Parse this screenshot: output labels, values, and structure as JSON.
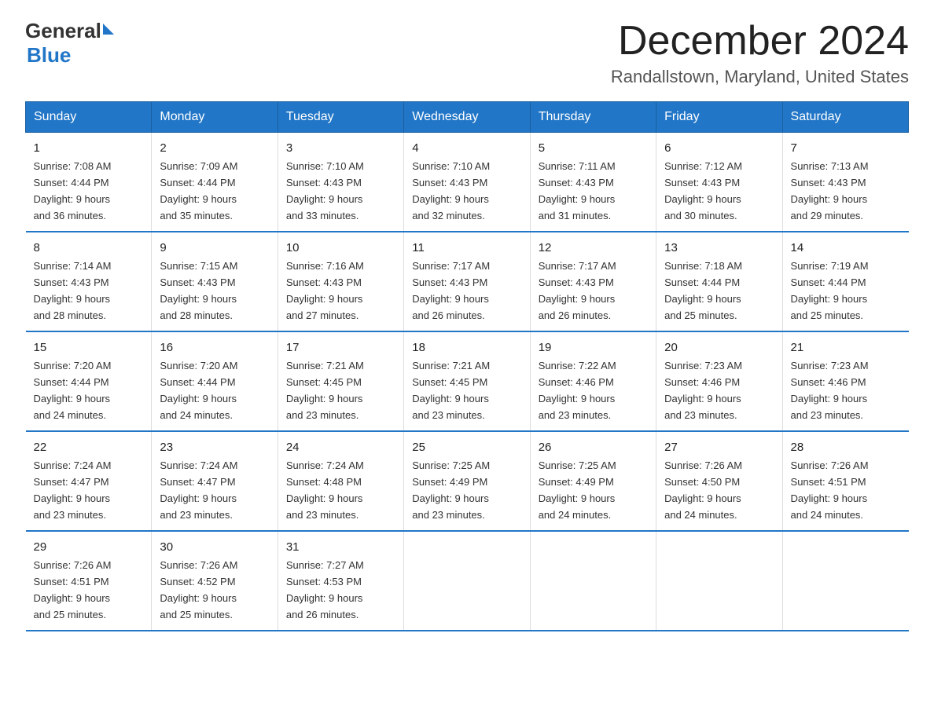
{
  "logo": {
    "general": "General",
    "blue": "Blue",
    "triangle": "▶"
  },
  "title": "December 2024",
  "subtitle": "Randallstown, Maryland, United States",
  "days_of_week": [
    "Sunday",
    "Monday",
    "Tuesday",
    "Wednesday",
    "Thursday",
    "Friday",
    "Saturday"
  ],
  "weeks": [
    [
      {
        "day": "1",
        "sunrise": "7:08 AM",
        "sunset": "4:44 PM",
        "daylight": "9 hours and 36 minutes."
      },
      {
        "day": "2",
        "sunrise": "7:09 AM",
        "sunset": "4:44 PM",
        "daylight": "9 hours and 35 minutes."
      },
      {
        "day": "3",
        "sunrise": "7:10 AM",
        "sunset": "4:43 PM",
        "daylight": "9 hours and 33 minutes."
      },
      {
        "day": "4",
        "sunrise": "7:10 AM",
        "sunset": "4:43 PM",
        "daylight": "9 hours and 32 minutes."
      },
      {
        "day": "5",
        "sunrise": "7:11 AM",
        "sunset": "4:43 PM",
        "daylight": "9 hours and 31 minutes."
      },
      {
        "day": "6",
        "sunrise": "7:12 AM",
        "sunset": "4:43 PM",
        "daylight": "9 hours and 30 minutes."
      },
      {
        "day": "7",
        "sunrise": "7:13 AM",
        "sunset": "4:43 PM",
        "daylight": "9 hours and 29 minutes."
      }
    ],
    [
      {
        "day": "8",
        "sunrise": "7:14 AM",
        "sunset": "4:43 PM",
        "daylight": "9 hours and 28 minutes."
      },
      {
        "day": "9",
        "sunrise": "7:15 AM",
        "sunset": "4:43 PM",
        "daylight": "9 hours and 28 minutes."
      },
      {
        "day": "10",
        "sunrise": "7:16 AM",
        "sunset": "4:43 PM",
        "daylight": "9 hours and 27 minutes."
      },
      {
        "day": "11",
        "sunrise": "7:17 AM",
        "sunset": "4:43 PM",
        "daylight": "9 hours and 26 minutes."
      },
      {
        "day": "12",
        "sunrise": "7:17 AM",
        "sunset": "4:43 PM",
        "daylight": "9 hours and 26 minutes."
      },
      {
        "day": "13",
        "sunrise": "7:18 AM",
        "sunset": "4:44 PM",
        "daylight": "9 hours and 25 minutes."
      },
      {
        "day": "14",
        "sunrise": "7:19 AM",
        "sunset": "4:44 PM",
        "daylight": "9 hours and 25 minutes."
      }
    ],
    [
      {
        "day": "15",
        "sunrise": "7:20 AM",
        "sunset": "4:44 PM",
        "daylight": "9 hours and 24 minutes."
      },
      {
        "day": "16",
        "sunrise": "7:20 AM",
        "sunset": "4:44 PM",
        "daylight": "9 hours and 24 minutes."
      },
      {
        "day": "17",
        "sunrise": "7:21 AM",
        "sunset": "4:45 PM",
        "daylight": "9 hours and 23 minutes."
      },
      {
        "day": "18",
        "sunrise": "7:21 AM",
        "sunset": "4:45 PM",
        "daylight": "9 hours and 23 minutes."
      },
      {
        "day": "19",
        "sunrise": "7:22 AM",
        "sunset": "4:46 PM",
        "daylight": "9 hours and 23 minutes."
      },
      {
        "day": "20",
        "sunrise": "7:23 AM",
        "sunset": "4:46 PM",
        "daylight": "9 hours and 23 minutes."
      },
      {
        "day": "21",
        "sunrise": "7:23 AM",
        "sunset": "4:46 PM",
        "daylight": "9 hours and 23 minutes."
      }
    ],
    [
      {
        "day": "22",
        "sunrise": "7:24 AM",
        "sunset": "4:47 PM",
        "daylight": "9 hours and 23 minutes."
      },
      {
        "day": "23",
        "sunrise": "7:24 AM",
        "sunset": "4:47 PM",
        "daylight": "9 hours and 23 minutes."
      },
      {
        "day": "24",
        "sunrise": "7:24 AM",
        "sunset": "4:48 PM",
        "daylight": "9 hours and 23 minutes."
      },
      {
        "day": "25",
        "sunrise": "7:25 AM",
        "sunset": "4:49 PM",
        "daylight": "9 hours and 23 minutes."
      },
      {
        "day": "26",
        "sunrise": "7:25 AM",
        "sunset": "4:49 PM",
        "daylight": "9 hours and 24 minutes."
      },
      {
        "day": "27",
        "sunrise": "7:26 AM",
        "sunset": "4:50 PM",
        "daylight": "9 hours and 24 minutes."
      },
      {
        "day": "28",
        "sunrise": "7:26 AM",
        "sunset": "4:51 PM",
        "daylight": "9 hours and 24 minutes."
      }
    ],
    [
      {
        "day": "29",
        "sunrise": "7:26 AM",
        "sunset": "4:51 PM",
        "daylight": "9 hours and 25 minutes."
      },
      {
        "day": "30",
        "sunrise": "7:26 AM",
        "sunset": "4:52 PM",
        "daylight": "9 hours and 25 minutes."
      },
      {
        "day": "31",
        "sunrise": "7:27 AM",
        "sunset": "4:53 PM",
        "daylight": "9 hours and 26 minutes."
      },
      {
        "day": "",
        "sunrise": "",
        "sunset": "",
        "daylight": ""
      },
      {
        "day": "",
        "sunrise": "",
        "sunset": "",
        "daylight": ""
      },
      {
        "day": "",
        "sunrise": "",
        "sunset": "",
        "daylight": ""
      },
      {
        "day": "",
        "sunrise": "",
        "sunset": "",
        "daylight": ""
      }
    ]
  ],
  "labels": {
    "sunrise_prefix": "Sunrise: ",
    "sunset_prefix": "Sunset: ",
    "daylight_prefix": "Daylight: "
  }
}
